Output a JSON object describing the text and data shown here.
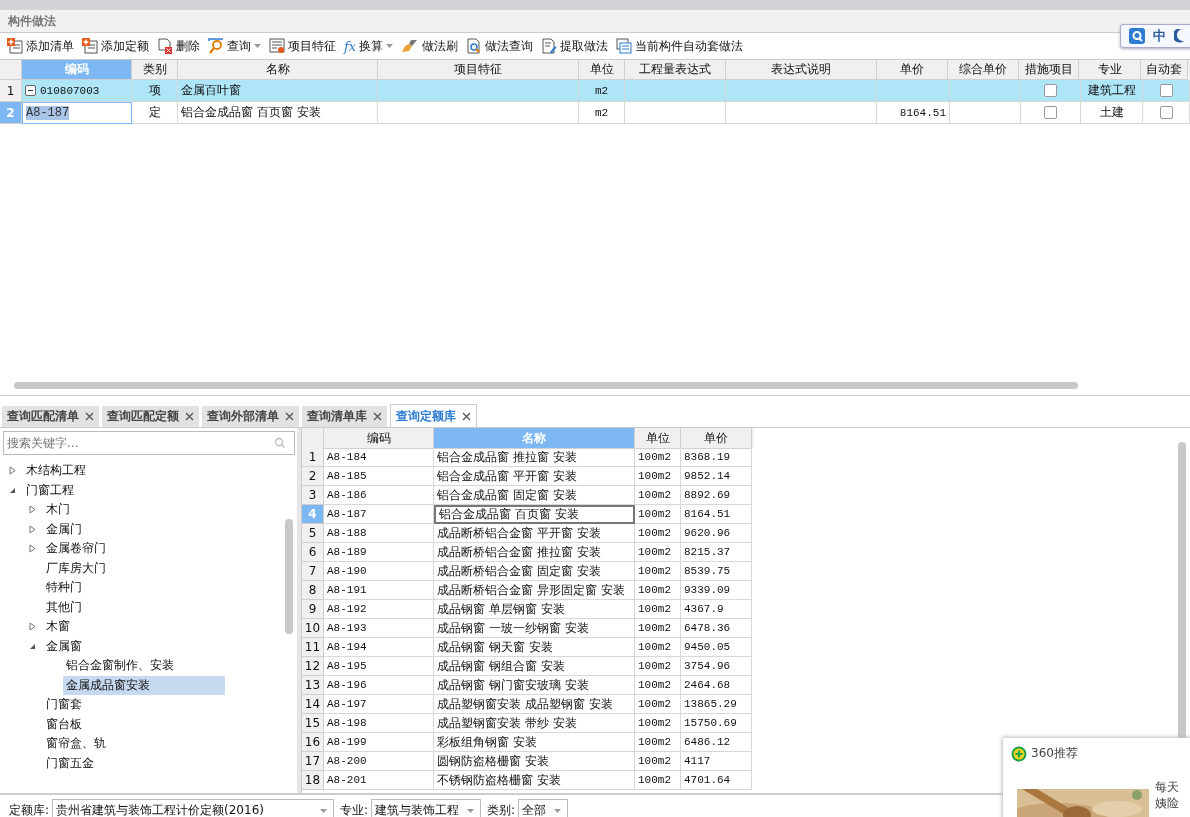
{
  "panel_title": "构件做法",
  "toolbar": [
    {
      "label": "添加清单",
      "kind": "add"
    },
    {
      "label": "添加定额",
      "kind": "add"
    },
    {
      "label": "删除",
      "kind": "delete"
    },
    {
      "label": "查询",
      "kind": "search",
      "dropdown": true
    },
    {
      "label": "项目特征",
      "kind": "feature"
    },
    {
      "label": "换算",
      "kind": "formula",
      "glyph": "fx",
      "dropdown": true
    },
    {
      "label": "做法刷",
      "kind": "brush"
    },
    {
      "label": "做法查询",
      "kind": "lookup"
    },
    {
      "label": "提取做法",
      "kind": "extract"
    },
    {
      "label": "当前构件自动套做法",
      "kind": "auto"
    }
  ],
  "ime": {
    "label": "中"
  },
  "upper_grid": {
    "columns": [
      {
        "label": "编码",
        "selected": true
      },
      {
        "label": "类别",
        "selected": false
      },
      {
        "label": "名称",
        "selected": false
      },
      {
        "label": "项目特征",
        "selected": false
      },
      {
        "label": "单位",
        "selected": false
      },
      {
        "label": "工程量表达式",
        "selected": false
      },
      {
        "label": "表达式说明",
        "selected": false
      },
      {
        "label": "单价",
        "selected": false
      },
      {
        "label": "综合单价",
        "selected": false
      },
      {
        "label": "措施项目",
        "selected": false
      },
      {
        "label": "专业",
        "selected": false
      },
      {
        "label": "自动套",
        "selected": false
      }
    ],
    "rows": [
      {
        "number": "1",
        "kind": "bill",
        "selected": false,
        "expanded": true,
        "editing": false,
        "code": "010807003",
        "type": "项",
        "name": "金属百叶窗",
        "unit": "m2",
        "measure": false,
        "specialty": "建筑工程",
        "auto": false
      },
      {
        "number": "2",
        "kind": "quota",
        "selected": true,
        "editing": true,
        "code": "A8-187",
        "type": "定",
        "name": "铝合金成品窗 百页窗 安装",
        "unit": "m2",
        "price": "8164.51",
        "measure": false,
        "specialty": "土建",
        "auto": false
      }
    ]
  },
  "tabs": [
    {
      "label": "查询匹配清单",
      "selected": false
    },
    {
      "label": "查询匹配定额",
      "selected": false
    },
    {
      "label": "查询外部清单",
      "selected": false
    },
    {
      "label": "查询清单库",
      "selected": false
    },
    {
      "label": "查询定额库",
      "selected": true
    }
  ],
  "search": {
    "placeholder": "搜索关键字..."
  },
  "tree": [
    {
      "label": "木结构工程",
      "expanded": false,
      "selected": false
    },
    {
      "label": "门窗工程",
      "expanded": true,
      "selected": false,
      "children": [
        {
          "label": "木门",
          "expanded": false,
          "selected": false
        },
        {
          "label": "金属门",
          "expanded": false,
          "selected": false
        },
        {
          "label": "金属卷帘门",
          "expanded": false,
          "selected": false
        },
        {
          "label": "厂库房大门",
          "selected": false
        },
        {
          "label": "特种门",
          "selected": false
        },
        {
          "label": "其他门",
          "selected": false
        },
        {
          "label": "木窗",
          "expanded": false,
          "selected": false
        },
        {
          "label": "金属窗",
          "expanded": true,
          "selected": false,
          "children": [
            {
              "label": "铝合金窗制作、安装",
              "selected": false
            },
            {
              "label": "金属成品窗安装",
              "selected": true
            }
          ]
        },
        {
          "label": "门窗套",
          "selected": false
        },
        {
          "label": "窗台板",
          "selected": false
        },
        {
          "label": "窗帘盒、轨",
          "selected": false
        },
        {
          "label": "门窗五金",
          "selected": false
        }
      ]
    }
  ],
  "quota_grid": {
    "columns": [
      {
        "label": "编码",
        "selected": false
      },
      {
        "label": "名称",
        "selected": true
      },
      {
        "label": "单位",
        "selected": false
      },
      {
        "label": "单价",
        "selected": false
      }
    ],
    "rows": [
      {
        "number": "1",
        "code": "A8-184",
        "name": "铝合金成品窗 推拉窗 安装",
        "unit": "100m2",
        "price": "8368.19",
        "selected": false
      },
      {
        "number": "2",
        "code": "A8-185",
        "name": "铝合金成品窗 平开窗 安装",
        "unit": "100m2",
        "price": "9852.14",
        "selected": false
      },
      {
        "number": "3",
        "code": "A8-186",
        "name": "铝合金成品窗 固定窗 安装",
        "unit": "100m2",
        "price": "8892.69",
        "selected": false
      },
      {
        "number": "4",
        "code": "A8-187",
        "name": "铝合金成品窗 百页窗 安装",
        "unit": "100m2",
        "price": "8164.51",
        "selected": true
      },
      {
        "number": "5",
        "code": "A8-188",
        "name": "成品断桥铝合金窗 平开窗 安装",
        "unit": "100m2",
        "price": "9620.96",
        "selected": false
      },
      {
        "number": "6",
        "code": "A8-189",
        "name": "成品断桥铝合金窗 推拉窗 安装",
        "unit": "100m2",
        "price": "8215.37",
        "selected": false
      },
      {
        "number": "7",
        "code": "A8-190",
        "name": "成品断桥铝合金窗 固定窗 安装",
        "unit": "100m2",
        "price": "8539.75",
        "selected": false
      },
      {
        "number": "8",
        "code": "A8-191",
        "name": "成品断桥铝合金窗 异形固定窗 安装",
        "unit": "100m2",
        "price": "9339.09",
        "selected": false
      },
      {
        "number": "9",
        "code": "A8-192",
        "name": "成品钢窗 单层钢窗 安装",
        "unit": "100m2",
        "price": "4367.9",
        "selected": false
      },
      {
        "number": "10",
        "code": "A8-193",
        "name": "成品钢窗 一玻一纱钢窗 安装",
        "unit": "100m2",
        "price": "6478.36",
        "selected": false
      },
      {
        "number": "11",
        "code": "A8-194",
        "name": "成品钢窗 钢天窗 安装",
        "unit": "100m2",
        "price": "9450.05",
        "selected": false
      },
      {
        "number": "12",
        "code": "A8-195",
        "name": "成品钢窗 钢组合窗 安装",
        "unit": "100m2",
        "price": "3754.96",
        "selected": false
      },
      {
        "number": "13",
        "code": "A8-196",
        "name": "成品钢窗 钢门窗安玻璃 安装",
        "unit": "100m2",
        "price": "2464.68",
        "selected": false
      },
      {
        "number": "14",
        "code": "A8-197",
        "name": "成品塑钢窗安装 成品塑钢窗 安装",
        "unit": "100m2",
        "price": "13865.29",
        "selected": false
      },
      {
        "number": "15",
        "code": "A8-198",
        "name": "成品塑钢窗安装 带纱 安装",
        "unit": "100m2",
        "price": "15750.69",
        "selected": false
      },
      {
        "number": "16",
        "code": "A8-199",
        "name": "彩板组角钢窗 安装",
        "unit": "100m2",
        "price": "6486.12",
        "selected": false
      },
      {
        "number": "17",
        "code": "A8-200",
        "name": "圆钢防盗格栅窗 安装",
        "unit": "100m2",
        "price": "4117",
        "selected": false
      },
      {
        "number": "18",
        "code": "A8-201",
        "name": "不锈钢防盗格栅窗 安装",
        "unit": "100m2",
        "price": "4701.64",
        "selected": false
      }
    ]
  },
  "filters": [
    {
      "label": "定额库:",
      "value": "贵州省建筑与装饰工程计价定额(2016)"
    },
    {
      "label": "专业:",
      "value": "建筑与装饰工程"
    },
    {
      "label": "类别:",
      "value": "全部"
    }
  ],
  "popup": {
    "title": "360推荐",
    "lines": [
      "每天",
      "姨险"
    ]
  }
}
